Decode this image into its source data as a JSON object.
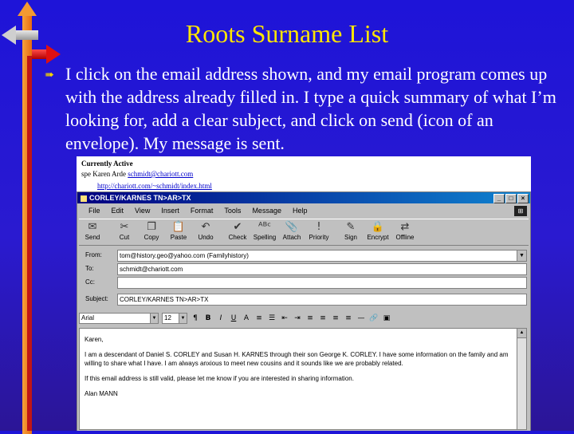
{
  "slide": {
    "title": "Roots Surname List",
    "bullet_icon": "arrow-bullet-icon",
    "body": "I click on the email address shown, and my email program comes up with the address already filled in. I type a quick summary of what I’m looking for, add a clear subject, and click on send (icon of an envelope). My message is sent."
  },
  "colors": {
    "background": "#2a1ad0",
    "title": "#ffe600",
    "text": "#ffffff"
  },
  "context": {
    "heading": "Currently Active",
    "line_prefix": "spe   Karen Arde",
    "email_link": "schmidt@chariott.com",
    "url": "http://chariott.com/~schmidt/index.html"
  },
  "window": {
    "title": "CORLEY/KARNES TN>AR>TX",
    "menu": [
      "File",
      "Edit",
      "View",
      "Insert",
      "Format",
      "Tools",
      "Message",
      "Help"
    ],
    "toolbar": [
      {
        "label": "Send",
        "icon": "envelope-send-icon"
      },
      {
        "label": "Cut",
        "icon": "scissors-icon"
      },
      {
        "label": "Copy",
        "icon": "copy-icon"
      },
      {
        "label": "Paste",
        "icon": "paste-icon"
      },
      {
        "label": "Undo",
        "icon": "undo-icon"
      },
      {
        "label": "Check",
        "icon": "check-names-icon"
      },
      {
        "label": "Spelling",
        "icon": "spelling-icon"
      },
      {
        "label": "Attach",
        "icon": "paperclip-icon"
      },
      {
        "label": "Priority",
        "icon": "priority-icon"
      },
      {
        "label": "Sign",
        "icon": "sign-icon"
      },
      {
        "label": "Encrypt",
        "icon": "encrypt-icon"
      },
      {
        "label": "Offline",
        "icon": "offline-icon"
      }
    ],
    "from_label": "From:",
    "from_value": "tom@history.geo@yahoo.com    (Familyhistory)",
    "to_label": "To:",
    "to_value": "schmidt@chariott.com",
    "cc_label": "Cc:",
    "cc_value": "",
    "subject_label": "Subject:",
    "subject_value": "CORLEY/KARNES TN>AR>TX",
    "font_name": "Arial",
    "font_size": "12",
    "body": [
      "Karen,",
      "I am a descendant of Daniel S. CORLEY and Susan H. KARNES through their son George K. CORLEY. I have some information on the family and am willing to share what I have. I am always anxious to meet new cousins and it sounds like we are probably related.",
      "If this email address is still valid, please let me know if you are interested in sharing information.",
      "Alan MANN"
    ]
  }
}
